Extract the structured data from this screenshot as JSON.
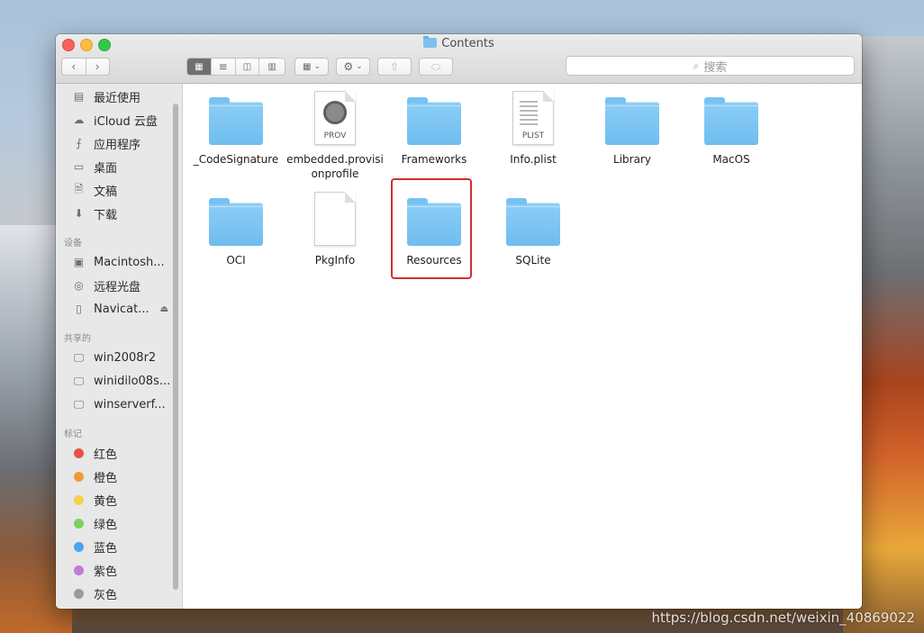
{
  "window": {
    "title": "Contents"
  },
  "toolbar": {
    "back_icon": "chevron-left-icon",
    "forward_icon": "chevron-right-icon",
    "search_placeholder": "搜索"
  },
  "sidebar": {
    "favorites": [
      {
        "label": "最近使用",
        "icon": "recents-icon"
      },
      {
        "label": "iCloud 云盘",
        "icon": "cloud-icon"
      },
      {
        "label": "应用程序",
        "icon": "applications-icon"
      },
      {
        "label": "桌面",
        "icon": "desktop-icon"
      },
      {
        "label": "文稿",
        "icon": "documents-icon"
      },
      {
        "label": "下载",
        "icon": "downloads-icon"
      }
    ],
    "devices_header": "设备",
    "devices": [
      {
        "label": "Macintosh..."
      },
      {
        "label": "远程光盘"
      },
      {
        "label": "Navicat..."
      }
    ],
    "shared_header": "共享的",
    "shared": [
      {
        "label": "win2008r2"
      },
      {
        "label": "winidilo08s..."
      },
      {
        "label": "winserverf..."
      }
    ],
    "tags_header": "标记",
    "tags": [
      {
        "label": "红色",
        "color": "#e5534b"
      },
      {
        "label": "橙色",
        "color": "#ef9a3a"
      },
      {
        "label": "黄色",
        "color": "#f5d04a"
      },
      {
        "label": "绿色",
        "color": "#7bd162"
      },
      {
        "label": "蓝色",
        "color": "#4aa4f0"
      },
      {
        "label": "紫色",
        "color": "#c07ad8"
      },
      {
        "label": "灰色",
        "color": "#9b9b9b"
      }
    ]
  },
  "files": [
    {
      "name": "_CodeSignature",
      "type": "folder"
    },
    {
      "name": "embedded.provisi onprofile",
      "type": "provision",
      "tag": "PROV"
    },
    {
      "name": "Frameworks",
      "type": "folder"
    },
    {
      "name": "Info.plist",
      "type": "plist",
      "tag": "PLIST"
    },
    {
      "name": "Library",
      "type": "folder"
    },
    {
      "name": "MacOS",
      "type": "folder"
    },
    {
      "name": "OCI",
      "type": "folder"
    },
    {
      "name": "PkgInfo",
      "type": "document"
    },
    {
      "name": "Resources",
      "type": "folder",
      "highlighted": true
    },
    {
      "name": "SQLite",
      "type": "folder"
    }
  ],
  "watermark": "https://blog.csdn.net/weixin_40869022"
}
